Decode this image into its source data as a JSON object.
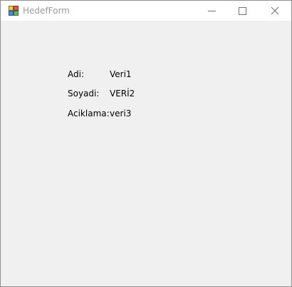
{
  "window": {
    "title": "HedefForm",
    "icon": "winforms-app-icon",
    "controls": {
      "minimize": "minimize-icon",
      "maximize": "maximize-icon",
      "close": "close-icon"
    }
  },
  "form": {
    "fields": [
      {
        "label": "Adi:",
        "value": "Veri1"
      },
      {
        "label": "Soyadi:",
        "value": "VERİ2"
      },
      {
        "label": "Aciklama:",
        "value": "veri3"
      }
    ]
  },
  "colors": {
    "titlebar": "#ffffff",
    "client_background": "#f0f0f0",
    "title_text": "#9a9a9a",
    "border": "#8f8f8f",
    "text": "#000000"
  }
}
